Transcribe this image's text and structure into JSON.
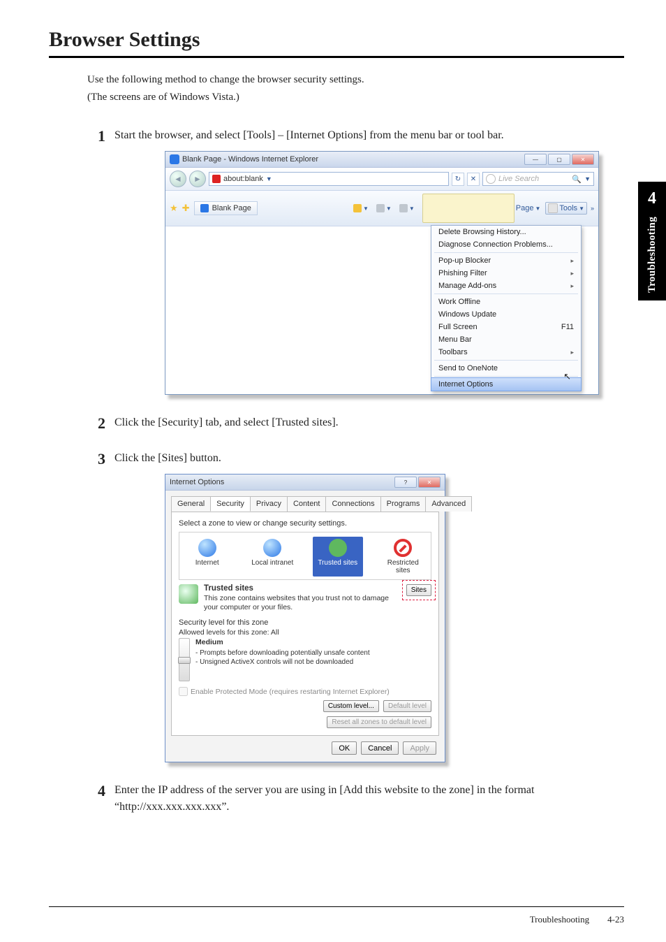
{
  "page": {
    "title": "Browser Settings",
    "intro1": "Use the following method to change the browser security settings.",
    "intro2": "(The screens are of Windows Vista.)",
    "footer": "Troubleshooting  4-23"
  },
  "sidetab": {
    "num": "4",
    "label": "Troubleshooting"
  },
  "steps": {
    "n1": "1",
    "s1": "Start the browser, and select [Tools] – [Internet Options] from the menu bar or tool bar.",
    "n2": "2",
    "s2": "Click the [Security] tab, and select [Trusted sites].",
    "n3": "3",
    "s3": "Click the [Sites] button.",
    "n4": "4",
    "s4": "Enter the IP address of the server you are using in [Add this website to the zone] in the format “http://xxx.xxx.xxx.xxx”."
  },
  "ie": {
    "winTitle": "Blank Page - Windows Internet Explorer",
    "addr": "about:blank",
    "searchPH": "Live Search",
    "tab": "Blank Page",
    "tools": {
      "page": "Page",
      "tools": "Tools"
    },
    "menu": {
      "m1": "Delete Browsing History...",
      "m2": "Diagnose Connection Problems...",
      "m3": "Pop-up Blocker",
      "m4": "Phishing Filter",
      "m5": "Manage Add-ons",
      "m6": "Work Offline",
      "m7": "Windows Update",
      "m8": "Full Screen",
      "m8s": "F11",
      "m9": "Menu Bar",
      "m10": "Toolbars",
      "m11": "Send to OneNote",
      "m12": "Internet Options"
    }
  },
  "io": {
    "title": "Internet Options",
    "tabs": {
      "general": "General",
      "security": "Security",
      "privacy": "Privacy",
      "content": "Content",
      "connections": "Connections",
      "programs": "Programs",
      "advanced": "Advanced"
    },
    "hint": "Select a zone to view or change security settings.",
    "zones": {
      "internet": "Internet",
      "local": "Local intranet",
      "trusted": "Trusted sites",
      "restricted": "Restricted sites"
    },
    "trusted": {
      "title": "Trusted sites",
      "body": "This zone contains websites that you trust not to damage your computer or your files.",
      "btn": "Sites"
    },
    "sec": {
      "lbl": "Security level for this zone",
      "allowed": "Allowed levels for this zone: All",
      "level": "Medium",
      "d1": "- Prompts before downloading potentially unsafe content",
      "d2": "- Unsigned ActiveX controls will not be downloaded",
      "chk": "Enable Protected Mode (requires restarting Internet Explorer)",
      "custom": "Custom level...",
      "default": "Default level",
      "reset": "Reset all zones to default level"
    },
    "ok": "OK",
    "cancel": "Cancel",
    "apply": "Apply"
  }
}
